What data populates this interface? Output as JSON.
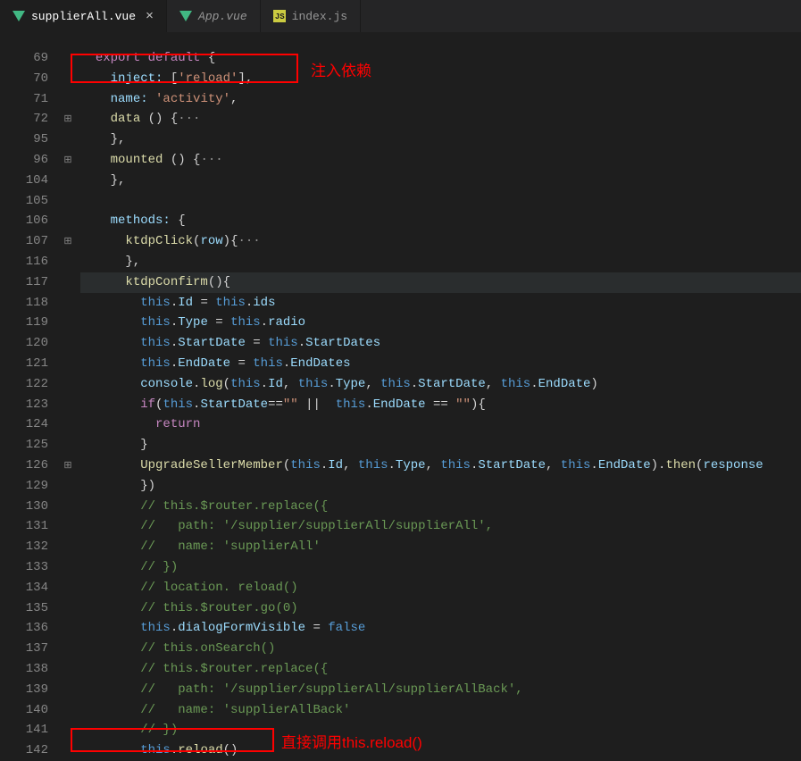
{
  "tabs": [
    {
      "label": "supplierAll.vue",
      "icon": "vue",
      "active": true,
      "closeable": true,
      "italic": false
    },
    {
      "label": "App.vue",
      "icon": "vue",
      "active": false,
      "closeable": false,
      "italic": true
    },
    {
      "label": "index.js",
      "icon": "js",
      "active": false,
      "closeable": false,
      "italic": false
    }
  ],
  "annotations": {
    "a1": "注入依赖",
    "a2": "直接调用this.reload()"
  },
  "lines": [
    {
      "num": "69",
      "fold": "",
      "tokens": [
        [
          "  ",
          ""
        ],
        [
          "export",
          "c-keyword2"
        ],
        [
          " ",
          ""
        ],
        [
          "default",
          "c-keyword2"
        ],
        [
          " {",
          "c-punc"
        ]
      ]
    },
    {
      "num": "70",
      "fold": "",
      "tokens": [
        [
          "    ",
          ""
        ],
        [
          "inject:",
          "c-var"
        ],
        [
          " [",
          "c-punc"
        ],
        [
          "'reload'",
          "c-string"
        ],
        [
          "],",
          "c-punc"
        ]
      ]
    },
    {
      "num": "71",
      "fold": "",
      "tokens": [
        [
          "    ",
          ""
        ],
        [
          "name:",
          "c-var"
        ],
        [
          " ",
          "c-punc"
        ],
        [
          "'activity'",
          "c-string"
        ],
        [
          ",",
          "c-punc"
        ]
      ]
    },
    {
      "num": "72",
      "fold": "⊞",
      "tokens": [
        [
          "    ",
          ""
        ],
        [
          "data",
          "c-func"
        ],
        [
          " () {",
          "c-punc"
        ],
        [
          "···",
          "c-dots"
        ]
      ]
    },
    {
      "num": "95",
      "fold": "",
      "tokens": [
        [
          "    },",
          "c-punc"
        ]
      ]
    },
    {
      "num": "96",
      "fold": "⊞",
      "tokens": [
        [
          "    ",
          ""
        ],
        [
          "mounted",
          "c-func"
        ],
        [
          " () {",
          "c-punc"
        ],
        [
          "···",
          "c-dots"
        ]
      ]
    },
    {
      "num": "104",
      "fold": "",
      "tokens": [
        [
          "    },",
          "c-punc"
        ]
      ]
    },
    {
      "num": "105",
      "fold": "",
      "tokens": [
        [
          "",
          ""
        ]
      ]
    },
    {
      "num": "106",
      "fold": "",
      "tokens": [
        [
          "    ",
          ""
        ],
        [
          "methods:",
          "c-var"
        ],
        [
          " {",
          "c-punc"
        ]
      ]
    },
    {
      "num": "107",
      "fold": "⊞",
      "tokens": [
        [
          "      ",
          ""
        ],
        [
          "ktdpClick",
          "c-func"
        ],
        [
          "(",
          "c-punc"
        ],
        [
          "row",
          "c-var"
        ],
        [
          "){",
          "c-punc"
        ],
        [
          "···",
          "c-dots"
        ]
      ]
    },
    {
      "num": "116",
      "fold": "",
      "tokens": [
        [
          "      },",
          "c-punc"
        ]
      ]
    },
    {
      "num": "117",
      "fold": "",
      "hl": true,
      "tokens": [
        [
          "      ",
          ""
        ],
        [
          "ktdpConfirm",
          "c-func"
        ],
        [
          "(){",
          "c-punc"
        ]
      ]
    },
    {
      "num": "118",
      "fold": "",
      "tokens": [
        [
          "        ",
          ""
        ],
        [
          "this",
          "c-this"
        ],
        [
          ".",
          "c-punc"
        ],
        [
          "Id",
          "c-var"
        ],
        [
          " = ",
          "c-punc"
        ],
        [
          "this",
          "c-this"
        ],
        [
          ".",
          "c-punc"
        ],
        [
          "ids",
          "c-var"
        ]
      ]
    },
    {
      "num": "119",
      "fold": "",
      "tokens": [
        [
          "        ",
          ""
        ],
        [
          "this",
          "c-this"
        ],
        [
          ".",
          "c-punc"
        ],
        [
          "Type",
          "c-var"
        ],
        [
          " = ",
          "c-punc"
        ],
        [
          "this",
          "c-this"
        ],
        [
          ".",
          "c-punc"
        ],
        [
          "radio",
          "c-var"
        ]
      ]
    },
    {
      "num": "120",
      "fold": "",
      "tokens": [
        [
          "        ",
          ""
        ],
        [
          "this",
          "c-this"
        ],
        [
          ".",
          "c-punc"
        ],
        [
          "StartDate",
          "c-var"
        ],
        [
          " = ",
          "c-punc"
        ],
        [
          "this",
          "c-this"
        ],
        [
          ".",
          "c-punc"
        ],
        [
          "StartDates",
          "c-var"
        ]
      ]
    },
    {
      "num": "121",
      "fold": "",
      "tokens": [
        [
          "        ",
          ""
        ],
        [
          "this",
          "c-this"
        ],
        [
          ".",
          "c-punc"
        ],
        [
          "EndDate",
          "c-var"
        ],
        [
          " = ",
          "c-punc"
        ],
        [
          "this",
          "c-this"
        ],
        [
          ".",
          "c-punc"
        ],
        [
          "EndDates",
          "c-var"
        ]
      ]
    },
    {
      "num": "122",
      "fold": "",
      "tokens": [
        [
          "        ",
          ""
        ],
        [
          "console",
          "c-var"
        ],
        [
          ".",
          "c-punc"
        ],
        [
          "log",
          "c-func"
        ],
        [
          "(",
          "c-punc"
        ],
        [
          "this",
          "c-this"
        ],
        [
          ".",
          "c-punc"
        ],
        [
          "Id",
          "c-var"
        ],
        [
          ", ",
          "c-punc"
        ],
        [
          "this",
          "c-this"
        ],
        [
          ".",
          "c-punc"
        ],
        [
          "Type",
          "c-var"
        ],
        [
          ", ",
          "c-punc"
        ],
        [
          "this",
          "c-this"
        ],
        [
          ".",
          "c-punc"
        ],
        [
          "StartDate",
          "c-var"
        ],
        [
          ", ",
          "c-punc"
        ],
        [
          "this",
          "c-this"
        ],
        [
          ".",
          "c-punc"
        ],
        [
          "EndDate",
          "c-var"
        ],
        [
          ")",
          "c-punc"
        ]
      ]
    },
    {
      "num": "123",
      "fold": "",
      "tokens": [
        [
          "        ",
          ""
        ],
        [
          "if",
          "c-keyword2"
        ],
        [
          "(",
          "c-punc"
        ],
        [
          "this",
          "c-this"
        ],
        [
          ".",
          "c-punc"
        ],
        [
          "StartDate",
          "c-var"
        ],
        [
          "==",
          "c-punc"
        ],
        [
          "\"\"",
          "c-string"
        ],
        [
          " || ",
          "c-punc"
        ],
        [
          " ",
          ""
        ],
        [
          "this",
          "c-this"
        ],
        [
          ".",
          "c-punc"
        ],
        [
          "EndDate",
          "c-var"
        ],
        [
          " == ",
          "c-punc"
        ],
        [
          "\"\"",
          "c-string"
        ],
        [
          "){",
          "c-punc"
        ]
      ]
    },
    {
      "num": "124",
      "fold": "",
      "tokens": [
        [
          "          ",
          ""
        ],
        [
          "return",
          "c-keyword2"
        ]
      ]
    },
    {
      "num": "125",
      "fold": "",
      "tokens": [
        [
          "        }",
          "c-punc"
        ]
      ]
    },
    {
      "num": "126",
      "fold": "⊞",
      "tokens": [
        [
          "        ",
          ""
        ],
        [
          "UpgradeSellerMember",
          "c-func"
        ],
        [
          "(",
          "c-punc"
        ],
        [
          "this",
          "c-this"
        ],
        [
          ".",
          "c-punc"
        ],
        [
          "Id",
          "c-var"
        ],
        [
          ", ",
          "c-punc"
        ],
        [
          "this",
          "c-this"
        ],
        [
          ".",
          "c-punc"
        ],
        [
          "Type",
          "c-var"
        ],
        [
          ", ",
          "c-punc"
        ],
        [
          "this",
          "c-this"
        ],
        [
          ".",
          "c-punc"
        ],
        [
          "StartDate",
          "c-var"
        ],
        [
          ", ",
          "c-punc"
        ],
        [
          "this",
          "c-this"
        ],
        [
          ".",
          "c-punc"
        ],
        [
          "EndDate",
          "c-var"
        ],
        [
          ").",
          "c-punc"
        ],
        [
          "then",
          "c-func"
        ],
        [
          "(",
          "c-punc"
        ],
        [
          "response",
          "c-var"
        ],
        [
          " ",
          ""
        ]
      ]
    },
    {
      "num": "129",
      "fold": "",
      "tokens": [
        [
          "        })",
          "c-punc"
        ]
      ]
    },
    {
      "num": "130",
      "fold": "",
      "tokens": [
        [
          "        ",
          ""
        ],
        [
          "// this.$router.replace({",
          "c-comment"
        ]
      ]
    },
    {
      "num": "131",
      "fold": "",
      "tokens": [
        [
          "        ",
          ""
        ],
        [
          "//   path: '/supplier/supplierAll/supplierAll',",
          "c-comment"
        ]
      ]
    },
    {
      "num": "132",
      "fold": "",
      "tokens": [
        [
          "        ",
          ""
        ],
        [
          "//   name: 'supplierAll'",
          "c-comment"
        ]
      ]
    },
    {
      "num": "133",
      "fold": "",
      "tokens": [
        [
          "        ",
          ""
        ],
        [
          "// })",
          "c-comment"
        ]
      ]
    },
    {
      "num": "134",
      "fold": "",
      "tokens": [
        [
          "        ",
          ""
        ],
        [
          "// location. reload()",
          "c-comment"
        ]
      ]
    },
    {
      "num": "135",
      "fold": "",
      "tokens": [
        [
          "        ",
          ""
        ],
        [
          "// this.$router.go(0)",
          "c-comment"
        ]
      ]
    },
    {
      "num": "136",
      "fold": "",
      "tokens": [
        [
          "        ",
          ""
        ],
        [
          "this",
          "c-this"
        ],
        [
          ".",
          "c-punc"
        ],
        [
          "dialogFormVisible",
          "c-var"
        ],
        [
          " = ",
          "c-punc"
        ],
        [
          "false",
          "c-keyword"
        ]
      ]
    },
    {
      "num": "137",
      "fold": "",
      "tokens": [
        [
          "        ",
          ""
        ],
        [
          "// this.onSearch()",
          "c-comment"
        ]
      ]
    },
    {
      "num": "138",
      "fold": "",
      "tokens": [
        [
          "        ",
          ""
        ],
        [
          "// this.$router.replace({",
          "c-comment"
        ]
      ]
    },
    {
      "num": "139",
      "fold": "",
      "tokens": [
        [
          "        ",
          ""
        ],
        [
          "//   path: '/supplier/supplierAll/supplierAllBack',",
          "c-comment"
        ]
      ]
    },
    {
      "num": "140",
      "fold": "",
      "tokens": [
        [
          "        ",
          ""
        ],
        [
          "//   name: 'supplierAllBack'",
          "c-comment"
        ]
      ]
    },
    {
      "num": "141",
      "fold": "",
      "tokens": [
        [
          "        ",
          ""
        ],
        [
          "// })",
          "c-comment"
        ]
      ]
    },
    {
      "num": "142",
      "fold": "",
      "tokens": [
        [
          "        ",
          ""
        ],
        [
          "this",
          "c-this"
        ],
        [
          ".",
          "c-punc"
        ],
        [
          "reload",
          "c-func"
        ],
        [
          "()",
          "c-punc"
        ]
      ]
    }
  ]
}
